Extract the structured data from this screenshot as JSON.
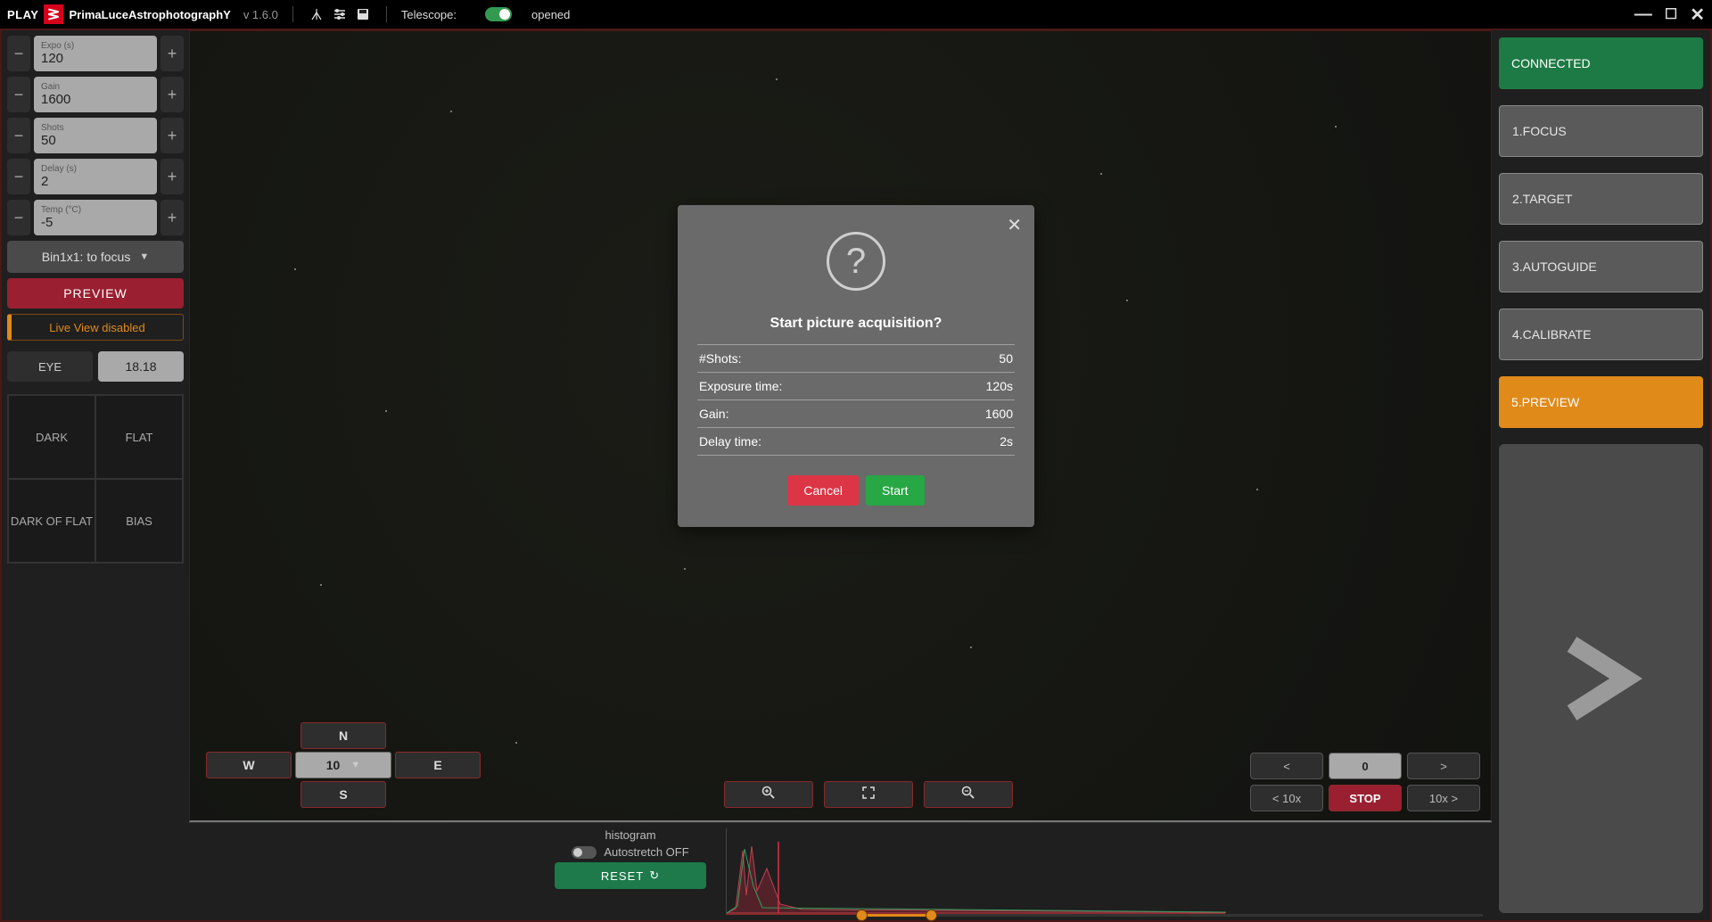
{
  "topbar": {
    "play": "PLAY",
    "brand_prefix": "P",
    "brand_mid1": "rima",
    "brand_L": "L",
    "brand_mid2": "uce",
    "brand_A": "A",
    "brand_mid3": "strophotograph",
    "brand_Y": "Y",
    "version": "v 1.6.0",
    "telescope_label": "Telescope:",
    "telescope_status": "opened"
  },
  "left": {
    "expo_label": "Expo (s)",
    "expo_value": "120",
    "gain_label": "Gain",
    "gain_value": "1600",
    "shots_label": "Shots",
    "shots_value": "50",
    "delay_label": "Delay (s)",
    "delay_value": "2",
    "temp_label": "Temp (°C)",
    "temp_value": "-5",
    "binning": "Bin1x1: to focus",
    "preview": "PREVIEW",
    "liveview": "Live View disabled",
    "eye": "EYE",
    "eye_value": "18.18",
    "dark": "DARK",
    "flat": "FLAT",
    "darkflat": "DARK OF FLAT",
    "bias": "BIAS"
  },
  "center": {
    "n": "N",
    "s": "S",
    "e": "E",
    "w": "W",
    "speed": "10",
    "frame_index": "0",
    "back": "<",
    "fwd": ">",
    "back10": "< 10x",
    "fwd10": "10x >",
    "stop": "STOP",
    "histogram_label": "histogram",
    "autostretch": "Autostretch OFF",
    "reset": "RESET"
  },
  "right": {
    "connected": "CONNECTED",
    "steps": [
      "1.FOCUS",
      "2.TARGET",
      "3.AUTOGUIDE",
      "4.CALIBRATE",
      "5.PREVIEW"
    ],
    "active_index": 4
  },
  "modal": {
    "title": "Start picture acquisition?",
    "rows": [
      {
        "label": "#Shots:",
        "value": "50"
      },
      {
        "label": "Exposure time:",
        "value": "120s"
      },
      {
        "label": "Gain:",
        "value": "1600"
      },
      {
        "label": "Delay time:",
        "value": "2s"
      }
    ],
    "cancel": "Cancel",
    "start": "Start"
  }
}
